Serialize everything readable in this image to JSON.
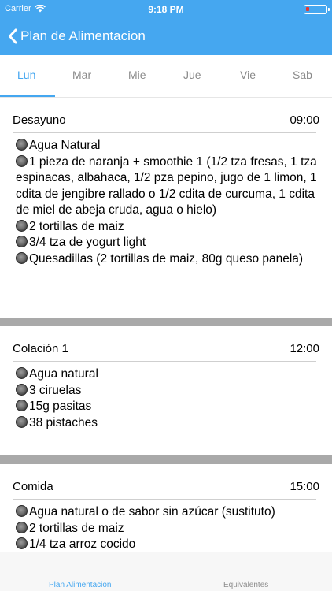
{
  "status_bar": {
    "carrier": "Carrier",
    "time": "9:18 PM"
  },
  "nav": {
    "title": "Plan de Alimentacion"
  },
  "day_tabs": [
    "Lun",
    "Mar",
    "Mie",
    "Jue",
    "Vie",
    "Sab"
  ],
  "meals": [
    {
      "name": "Desayuno",
      "time": "09:00",
      "items": [
        "Agua Natural",
        "1 pieza de naranja + smoothie 1 (1/2 tza fresas, 1 tza espinacas, albahaca, 1/2 pza pepino, jugo de 1 limon, 1 cdita de jengibre rallado o 1/2 cdita de curcuma, 1 cdita de miel de abeja cruda, agua o hielo)",
        "2 tortillas de maiz",
        "3/4 tza de yogurt light",
        "Quesadillas (2 tortillas de maiz, 80g queso panela)"
      ]
    },
    {
      "name": "Colación 1",
      "time": "12:00",
      "items": [
        "Agua natural",
        "3 ciruelas",
        "15g pasitas",
        "38 pistaches"
      ]
    },
    {
      "name": "Comida",
      "time": "15:00",
      "items": [
        "Agua natural o de sabor sin azúcar (sustituto)",
        "2 tortillas de maiz",
        "1/4 tza arroz cocido"
      ]
    }
  ],
  "tabbar": {
    "plan": "Plan Alimentacion",
    "equivalentes": "Equivalentes"
  },
  "colors": {
    "accent": "#45A7F0",
    "separator": "#A9A9A9"
  }
}
